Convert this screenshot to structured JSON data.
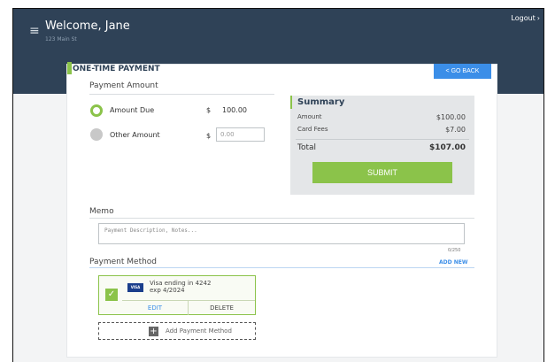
{
  "header": {
    "welcome": "Welcome, Jane",
    "address": "123 Main St",
    "logout": "Logout",
    "logout_chevron": "›"
  },
  "card": {
    "title": "ONE-TIME PAYMENT",
    "go_back": "< GO BACK"
  },
  "payment_amount": {
    "label": "Payment Amount",
    "options": [
      {
        "label": "Amount Due",
        "currency": "$",
        "value": "100.00",
        "selected": true
      },
      {
        "label": "Other Amount",
        "currency": "$",
        "placeholder": "0.00",
        "selected": false
      }
    ]
  },
  "summary": {
    "title": "Summary",
    "rows": [
      {
        "label": "Amount",
        "value": "$100.00"
      },
      {
        "label": "Card Fees",
        "value": "$7.00"
      }
    ],
    "total_label": "Total",
    "total_value": "$107.00",
    "submit": "SUBMIT"
  },
  "memo": {
    "label": "Memo",
    "placeholder": "Payment Description, Notes...",
    "counter": "0/250"
  },
  "payment_method": {
    "label": "Payment Method",
    "add_new": "ADD NEW",
    "card": {
      "brand": "VISA",
      "line1": "Visa ending in 4242",
      "line2": "exp 4/2024",
      "edit": "EDIT",
      "delete": "DELETE"
    },
    "add_method": "Add Payment Method"
  },
  "colors": {
    "header": "#2f4257",
    "accent_green": "#8bc34a",
    "link_blue": "#3b8ee8"
  }
}
